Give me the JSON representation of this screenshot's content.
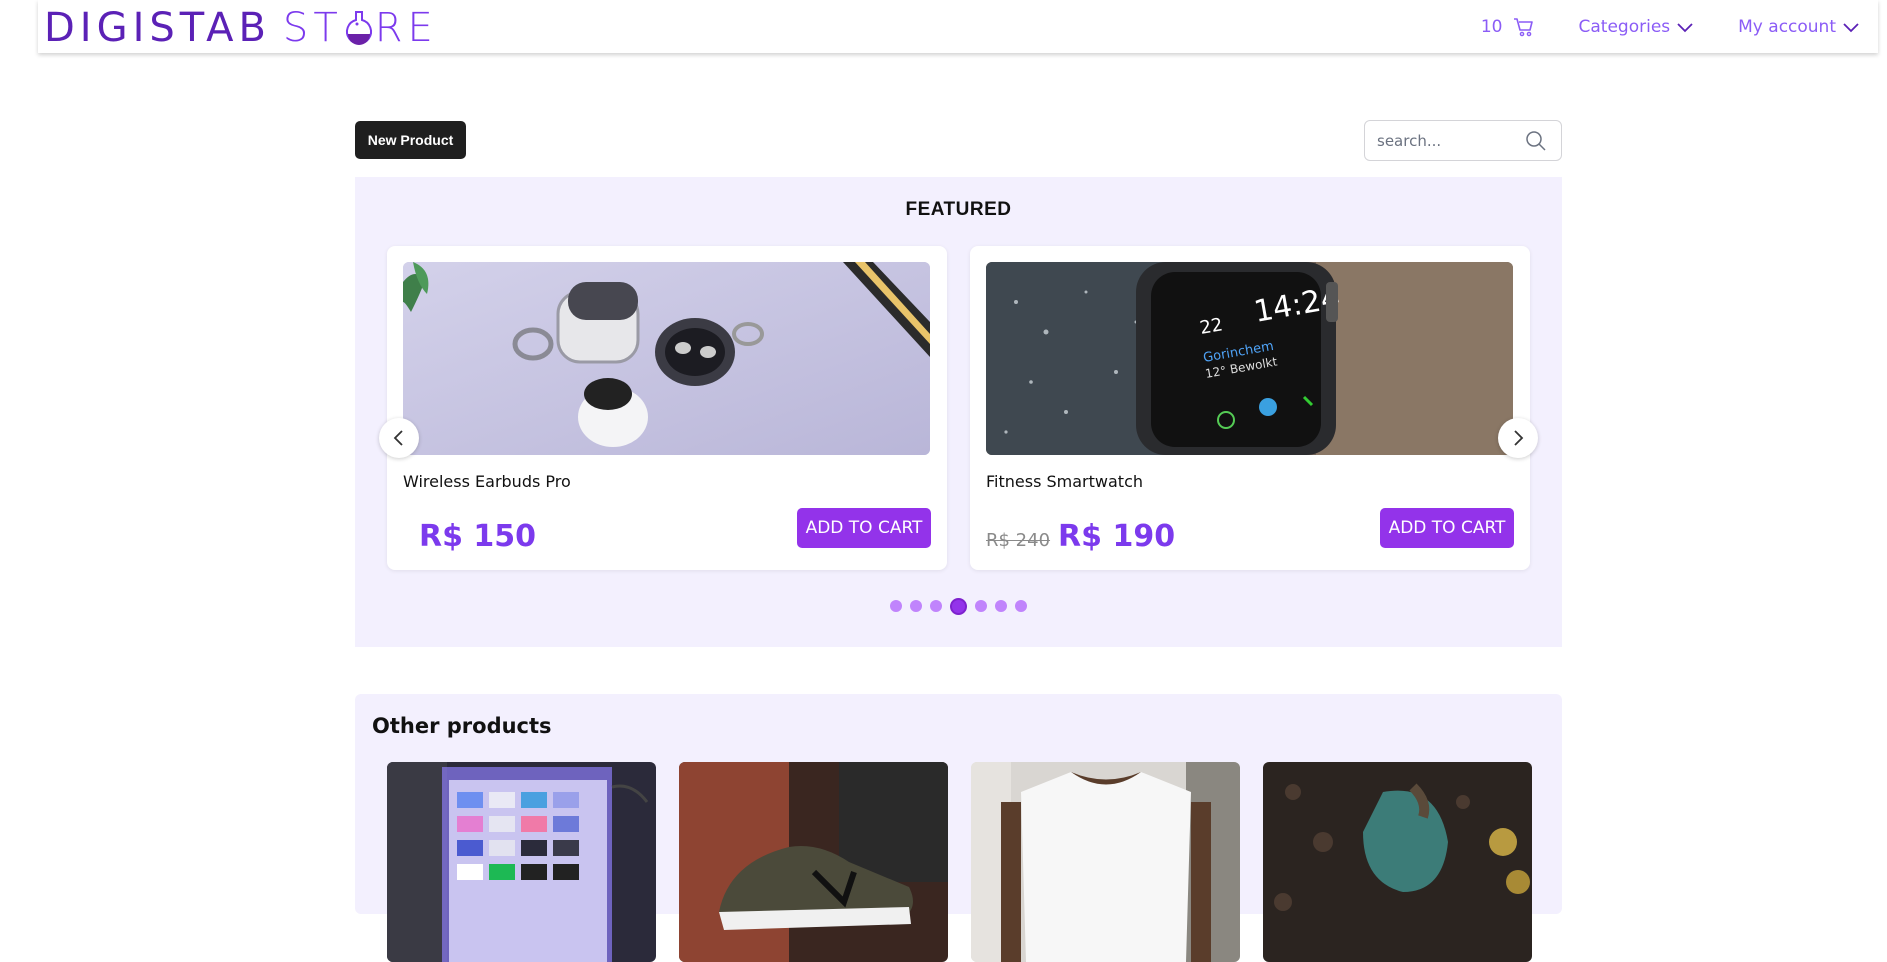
{
  "header": {
    "logo_text": "DIGISTAB",
    "logo_text_2": "ST",
    "logo_text_3": "RE",
    "cart_count": "10",
    "categories_label": "Categories",
    "account_label": "My account"
  },
  "toolbar": {
    "new_product_label": "New Product",
    "search_placeholder": "search..."
  },
  "featured": {
    "title": "FEATURED",
    "items": [
      {
        "name": "Wireless Earbuds Pro",
        "old_price": "",
        "price": "R$ 150",
        "button_label": "ADD TO CART"
      },
      {
        "name": "Fitness Smartwatch",
        "old_price": "R$ 240",
        "price": "R$ 190",
        "button_label": "ADD TO CART"
      }
    ],
    "dot_count": 7,
    "active_dot": 4
  },
  "other": {
    "title": "Other products",
    "items": [
      "tv",
      "sneaker",
      "tshirt",
      "garden"
    ]
  },
  "colors": {
    "brand": "#7c3aed",
    "button": "#9333ea",
    "section_bg": "#f3f0fe"
  }
}
